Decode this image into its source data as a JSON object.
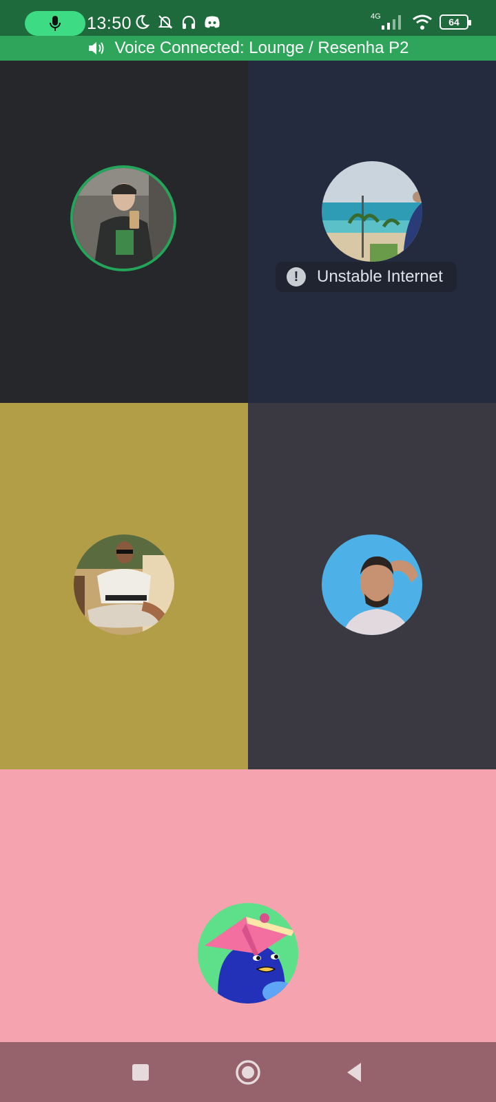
{
  "status_bar": {
    "time": "13:50",
    "network": "4G",
    "battery": "64",
    "icons": [
      "microphone-icon",
      "moon-icon",
      "bell-off-icon",
      "headphones-icon",
      "discord-icon",
      "signal-icon",
      "wifi-icon",
      "battery-icon"
    ]
  },
  "voice_bar": {
    "label": "Voice Connected: Lounge / Resenha P2",
    "icon": "speaker-icon"
  },
  "tiles": [
    {
      "background": "#25272a",
      "speaking": true
    },
    {
      "background": "#252b3e",
      "speaking": false,
      "status": "Unstable Internet",
      "status_icon": "exclamation-icon"
    },
    {
      "background": "#b29e46",
      "speaking": false
    },
    {
      "background": "#3a3942",
      "speaking": false
    },
    {
      "background": "#f6a3b0",
      "speaking": false
    }
  ],
  "colors": {
    "status_bar": "#1e6a3c",
    "voice_bar": "#2ea55a",
    "speaking_ring": "#23a55a",
    "nav_bar": "#96626b"
  },
  "nav_bar": {
    "buttons": [
      "recents-button",
      "home-button",
      "back-button"
    ]
  }
}
